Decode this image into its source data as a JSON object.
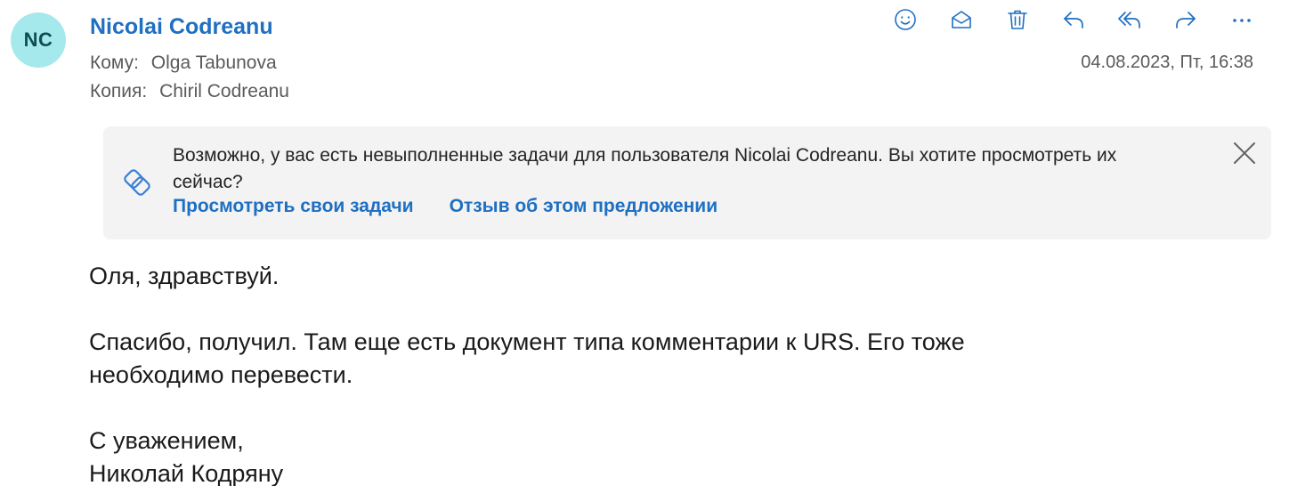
{
  "sender": {
    "initials": "NC",
    "name": "Nicolai Codreanu",
    "avatar_color": "#a6e9ec"
  },
  "recipients": {
    "to_label": "Кому:",
    "to_value": "Olga Tabunova",
    "cc_label": "Копия:",
    "cc_value": "Chiril Codreanu"
  },
  "date": "04.08.2023, Пт, 16:38",
  "toolbar": {
    "icons": [
      "emoji-icon",
      "mark-unread-icon",
      "delete-icon",
      "reply-icon",
      "reply-all-icon",
      "forward-icon",
      "more-icon"
    ]
  },
  "banner": {
    "text": "Возможно, у вас есть невыполненные задачи для пользователя Nicolai Codreanu. Вы хотите просмотреть их сейчас?",
    "link_primary": "Просмотреть свои задачи",
    "link_secondary": "Отзыв об этом предложении"
  },
  "message": {
    "greeting": "Оля, здравствуй.",
    "line1": "Спасибо, получил. Там еще есть документ типа комментарии к URS. Его тоже",
    "line2": "необходимо перевести.",
    "closing": "С уважением,",
    "signature": "Николай Кодряну"
  },
  "colors": {
    "accent": "#1f6fc2",
    "banner_bg": "#f3f3f3"
  }
}
